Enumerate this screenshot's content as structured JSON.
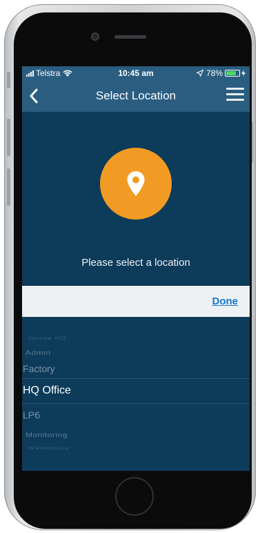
{
  "status_bar": {
    "carrier": "Telstra",
    "time": "10:45 am",
    "battery": "78%",
    "battery_level": 0.78,
    "battery_color": "#4cd964"
  },
  "nav": {
    "title": "Select Location",
    "back_icon": "chevron-left-icon",
    "menu_icon": "hamburger-menu-icon"
  },
  "hero": {
    "icon": "map-pin-icon",
    "accent": "#f29b24",
    "prompt": "Please select a location"
  },
  "toolbar": {
    "done_label": "Done",
    "done_color": "#1677d2"
  },
  "picker": {
    "selected": "HQ Office",
    "items": [
      "Onsite HQ",
      "Admin",
      "Factory",
      "HQ Office",
      "LP6",
      "Monitoring",
      "Warehouse"
    ]
  },
  "colors": {
    "screen_bg": "#0d3b5a",
    "bar_bg": "#2a5d80"
  }
}
